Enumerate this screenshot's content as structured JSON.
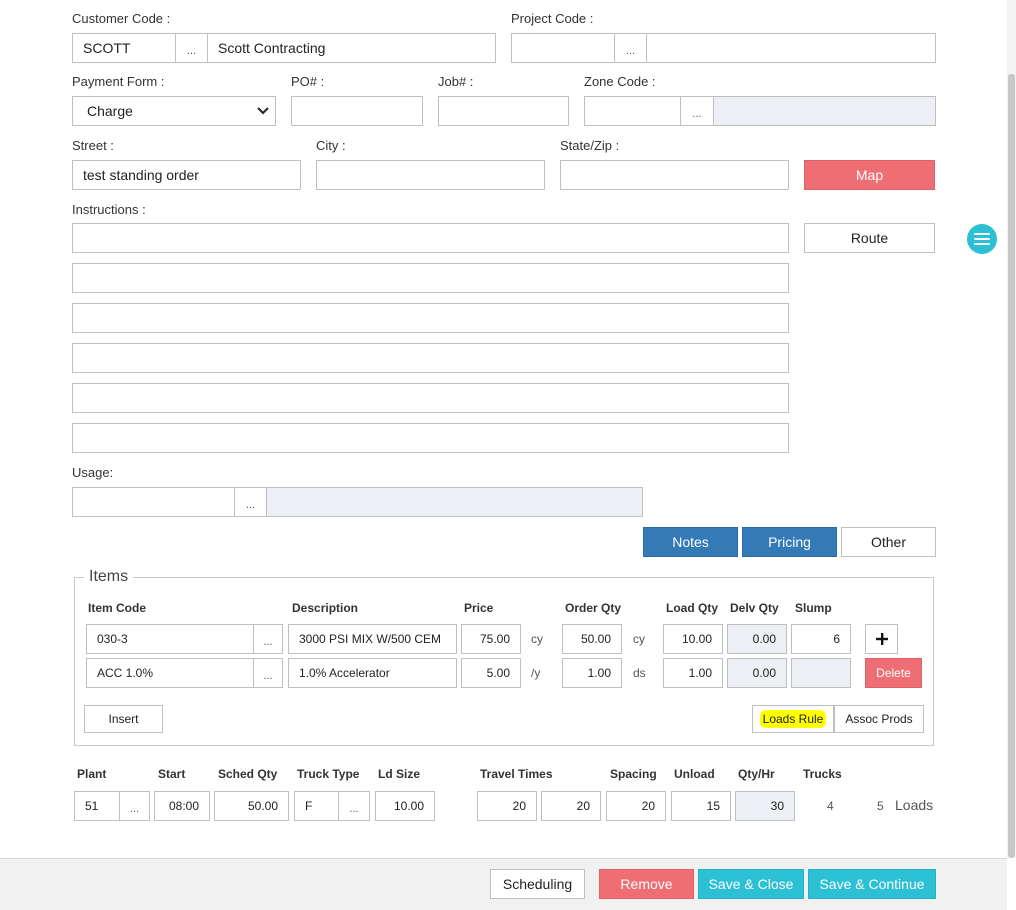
{
  "customer": {
    "label": "Customer Code :",
    "code": "SCOTT",
    "name": "Scott Contracting"
  },
  "project": {
    "label": "Project Code :",
    "code": "",
    "name": ""
  },
  "payment": {
    "label": "Payment Form :",
    "value": "Charge"
  },
  "po": {
    "label": "PO# :",
    "value": ""
  },
  "job": {
    "label": "Job# :",
    "value": ""
  },
  "zone": {
    "label": "Zone Code :",
    "code": "",
    "name": ""
  },
  "street": {
    "label": "Street :",
    "value": "test standing order"
  },
  "city": {
    "label": "City :",
    "value": ""
  },
  "statezip": {
    "label": "State/Zip :",
    "value": ""
  },
  "map_button": "Map",
  "route_button": "Route",
  "instructions": {
    "label": "Instructions :",
    "lines": [
      "",
      "",
      "",
      "",
      "",
      ""
    ]
  },
  "usage": {
    "label": "Usage:",
    "code": "",
    "name": ""
  },
  "tabs": {
    "notes": "Notes",
    "pricing": "Pricing",
    "other": "Other"
  },
  "items": {
    "legend": "Items",
    "headers": {
      "item_code": "Item Code",
      "description": "Description",
      "price": "Price",
      "order_qty": "Order Qty",
      "load_qty": "Load Qty",
      "delv_qty": "Delv Qty",
      "slump": "Slump"
    },
    "rows": [
      {
        "code": "030-3",
        "description": "3000 PSI MIX W/500 CEM",
        "price": "75.00",
        "price_unit": "cy",
        "order_qty": "50.00",
        "qty_unit": "cy",
        "load_qty": "10.00",
        "delv_qty": "0.00",
        "slump": "6"
      },
      {
        "code": "ACC 1.0%",
        "description": "1.0% Accelerator",
        "price": "5.00",
        "price_unit": "/y",
        "order_qty": "1.00",
        "qty_unit": "ds",
        "load_qty": "1.00",
        "delv_qty": "0.00",
        "slump": ""
      }
    ],
    "add_symbol": "+",
    "delete_button": "Delete",
    "insert_button": "Insert",
    "loads_rule_button": "Loads Rule",
    "assoc_prods_button": "Assoc Prods"
  },
  "schedule": {
    "headers": {
      "plant": "Plant",
      "start": "Start",
      "sched_qty": "Sched Qty",
      "truck_type": "Truck Type",
      "ld_size": "Ld Size",
      "travel_times": "Travel Times",
      "spacing": "Spacing",
      "unload": "Unload",
      "qty_hr": "Qty/Hr",
      "trucks": "Trucks"
    },
    "plant": "51",
    "start": "08:00",
    "sched_qty": "50.00",
    "truck_type": "F",
    "ld_size": "10.00",
    "travel_to": "20",
    "travel_from": "20",
    "spacing": "20",
    "unload": "15",
    "qty_hr": "30",
    "trucks": "4",
    "loads_count": "5",
    "loads_label": "Loads"
  },
  "footer": {
    "scheduling": "Scheduling",
    "remove": "Remove",
    "save_close": "Save & Close",
    "save_continue": "Save & Continue"
  },
  "dots": "...",
  "colors": {
    "accent_blue": "#337ab7",
    "danger": "#ee6e73",
    "teal": "#2bc0d4",
    "highlight": "#ffff00"
  },
  "menu_icon": "hamburger-menu-icon"
}
